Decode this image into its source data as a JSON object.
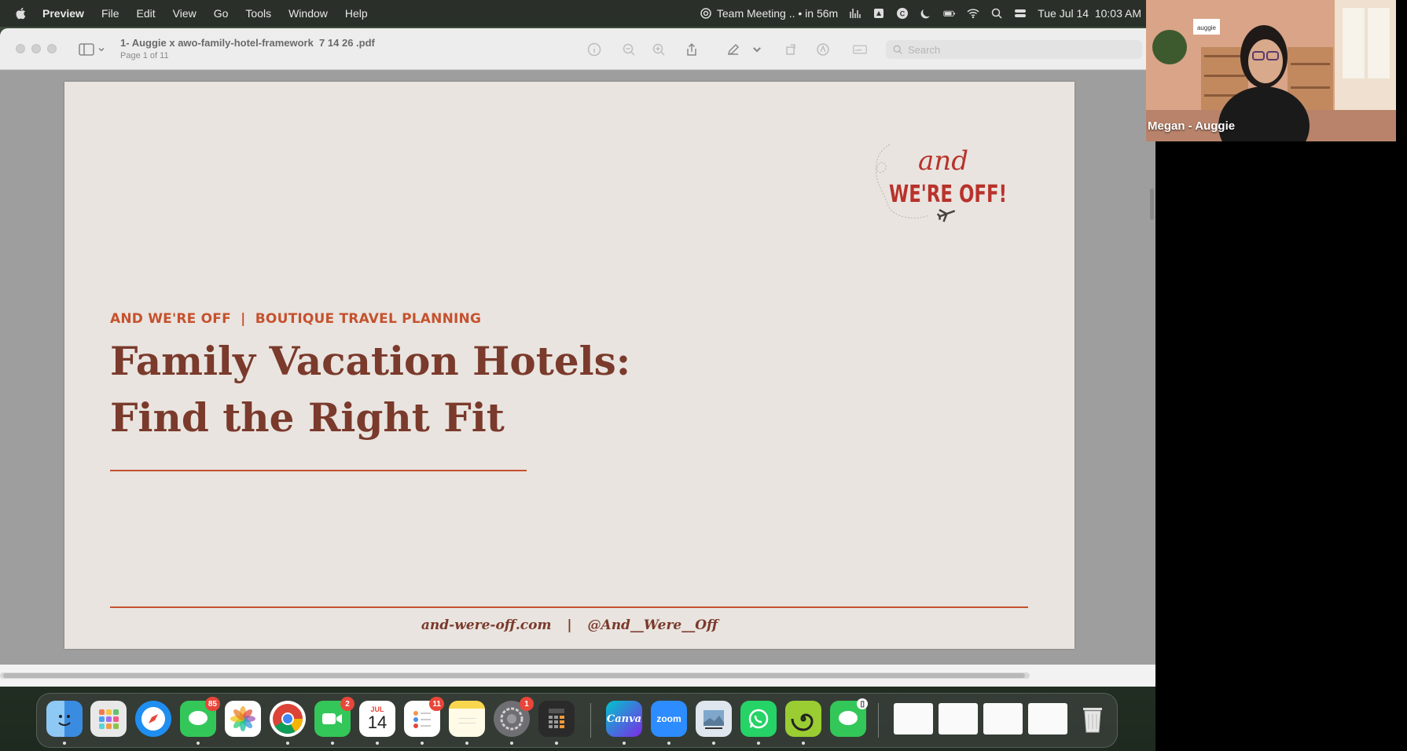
{
  "menubar": {
    "app_name": "Preview",
    "menus": [
      "File",
      "Edit",
      "View",
      "Go",
      "Tools",
      "Window",
      "Help"
    ],
    "meeting_text": "Team Meeting .. • in 56m",
    "datetime": "Tue Jul 14  10:03 AM"
  },
  "window": {
    "doc_title": "1- Auggie x awo-family-hotel-framework  7 14 26 .pdf",
    "page_info": "Page 1 of 11",
    "search_placeholder": "Search"
  },
  "page": {
    "kicker": "AND WE'RE OFF  |  BOUTIQUE TRAVEL PLANNING",
    "headline_line1": "Family Vacation Hotels:",
    "headline_line2": "Find the Right Fit",
    "footer_site": "and-were-off.com",
    "footer_sep": "|",
    "footer_handle": "@And__Were__Off",
    "logo_top": "and",
    "logo_main": "WE'RE OFF!"
  },
  "video": {
    "participant_name": "Megan - Auggie",
    "backdrop_sign": "auggie"
  },
  "dock": {
    "messages_badge": "85",
    "facetime_badge": "2",
    "calendar_month": "JUL",
    "calendar_day": "14",
    "reminders_badge": "11",
    "settings_badge": "1",
    "canva_label": "Canva",
    "zoom_label": "zoom"
  },
  "colors": {
    "page_bg": "#e9e4df",
    "accent_orange": "#c5522f",
    "headline_brown": "#7a3a2c",
    "logo_red": "#b8332c"
  }
}
